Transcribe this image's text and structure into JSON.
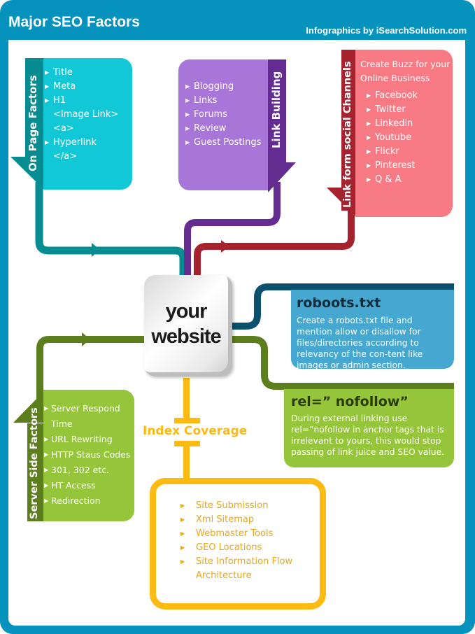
{
  "header": {
    "title": "Major SEO Factors",
    "credit": "Infographics by iSearchSolution.com"
  },
  "colors": {
    "frame": "#0593be",
    "on_page": "#13c8d6",
    "on_page_dark": "#078c91",
    "link_building": "#a876d8",
    "link_building_dark": "#642c91",
    "social": "#f87a84",
    "social_dark": "#a6222e",
    "robots": "#46a8d0",
    "robots_dark": "#0b516d",
    "server": "#95c53a",
    "server_dark": "#5d7e1c",
    "index": "#fdba12"
  },
  "center": {
    "line1": "your",
    "line2": "website"
  },
  "on_page": {
    "label": "On Page Factors",
    "items": [
      "Title",
      "Meta",
      "H1",
      "<Image Link>",
      "<a>",
      "Hyperlink",
      "</a>"
    ]
  },
  "link_building": {
    "label": "Link Building",
    "items": [
      "Blogging",
      "Links",
      "Forums",
      "Review",
      "Guest Postings"
    ]
  },
  "social": {
    "label": "Link form social Channels",
    "intro_line1": "Create Buzz for your",
    "intro_line2": "Online Business",
    "items": [
      "Facebook",
      "Twitter",
      "Linkedin",
      "Youtube",
      "Flickr",
      "Pinterest",
      "Q & A"
    ]
  },
  "robots": {
    "title": "roboots.txt",
    "text": "Create a robots.txt file and mention allow or disallow for files/directories according to relevancy of the con-tent like images or admin section."
  },
  "nofollow": {
    "title": "rel=” nofollow”",
    "text": "During external linking use rel=”nofollow in anchor tags that is irrelevant to yours, this would stop passing of link juice and SEO value."
  },
  "server": {
    "label": "Server Side Factors",
    "items": [
      "Server Respond",
      "Time",
      "URL Rewriting",
      "HTTP Staus Codes",
      "301, 302 etc.",
      "HT Access",
      "Redirection"
    ]
  },
  "index": {
    "label": "Index Coverage",
    "items": [
      "Site Submission",
      "Xml Sitemap",
      "Webmaster Tools",
      "GEO Locations",
      "Site Information Flow",
      "Architecture"
    ]
  }
}
